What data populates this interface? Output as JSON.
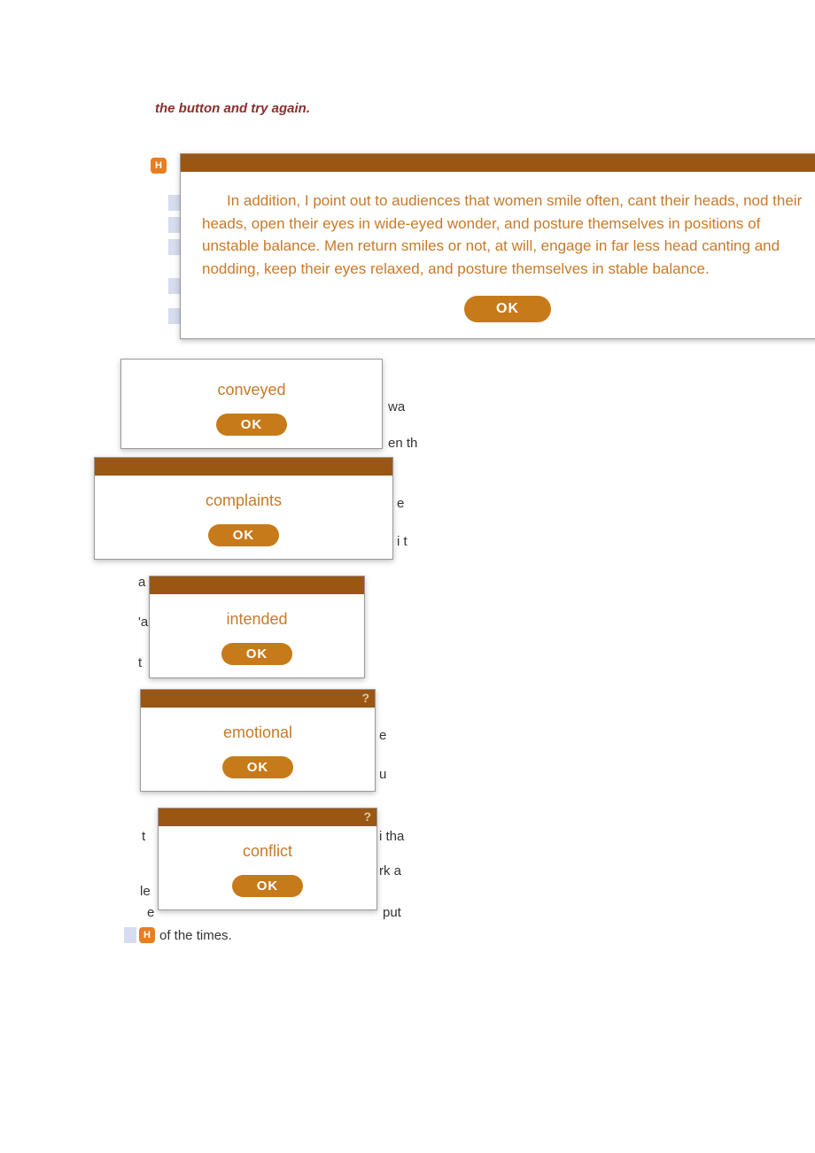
{
  "instruction": "the button and try again.",
  "main_modal": {
    "text": "In addition, I point out to audiences that women smile often, cant their heads, nod their heads, open their eyes in wide-eyed wonder, and posture themselves in positions of unstable balance. Men return smiles or not, at will, engage in far less head canting and nodding, keep their eyes relaxed, and posture themselves in stable balance.",
    "ok": "OK"
  },
  "modals": [
    {
      "text": "conveyed",
      "ok": "OK"
    },
    {
      "text": "complaints",
      "ok": "OK"
    },
    {
      "text": "intended",
      "ok": "OK"
    },
    {
      "text": "emotional",
      "ok": "OK"
    },
    {
      "text": "conflict",
      "ok": "OK"
    }
  ],
  "bg": {
    "frag_wa": "wa",
    "frag_en_th": "en th",
    "frag_e": "e",
    "frag_a": "a",
    "frag_t": "t",
    "frag_slash_a": "'a",
    "frag_n_t": "i t",
    "frag_e2": "e",
    "frag_u": "u",
    "frag_tha": "i tha",
    "frag_rk_a": "rk a",
    "frag_le": "le",
    "frag_e3": "e",
    "frag_put": "put",
    "frag_of_times": "of the times.",
    "h_label": "H"
  }
}
